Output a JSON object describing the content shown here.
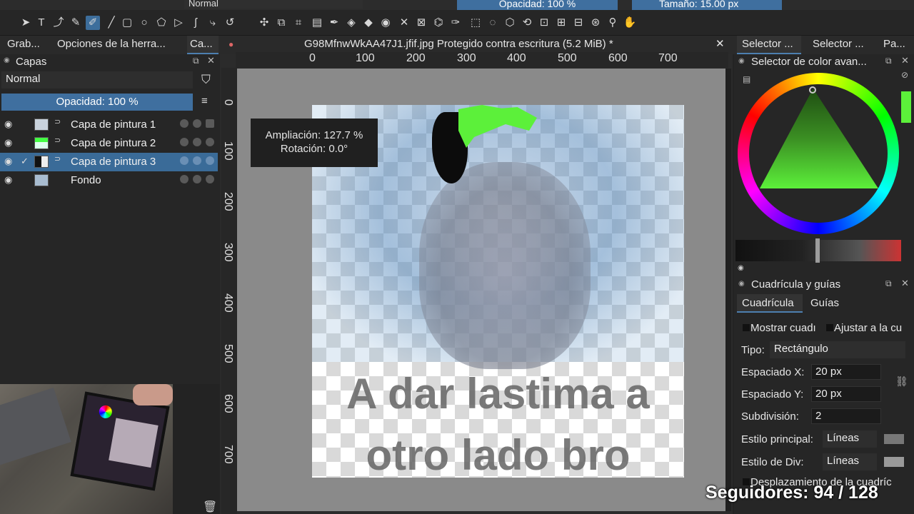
{
  "top": {
    "blend_mode": "Normal",
    "opacity": "Opacidad: 100 %",
    "size": "Tamaño: 15.00 px"
  },
  "tabs": {
    "left1": "Grab...",
    "left2": "Opciones de la herra...",
    "left3": "Ca...",
    "document": "G98MfnwWkAA47J1.jfif.jpg Protegido contra escritura (5.2 MiB) *",
    "right1": "Selector ...",
    "right2": "Selector ...",
    "right3": "Pa..."
  },
  "layers_panel": {
    "title": "Capas",
    "blend_mode": "Normal",
    "opacity": "Opacidad:  100 %",
    "layers": [
      {
        "name": "Capa de pintura 1",
        "selected": false
      },
      {
        "name": "Capa de pintura 2",
        "selected": false
      },
      {
        "name": "Capa de pintura 3",
        "selected": true
      },
      {
        "name": "Fondo",
        "selected": false
      }
    ]
  },
  "rulers": {
    "h": [
      "0",
      "100",
      "200",
      "300",
      "400",
      "500",
      "600",
      "700"
    ],
    "v": [
      "0",
      "100",
      "200",
      "300",
      "400",
      "500",
      "600",
      "700"
    ]
  },
  "canvas": {
    "zoom_line": "Ampliación: 127.7 %",
    "rotation_line": "Rotación: 0.0°",
    "text_line1": "A dar lastima a",
    "text_line2": "otro lado bro"
  },
  "color_selector": {
    "title": "Selector de color avan..."
  },
  "grid_panel": {
    "title": "Cuadrícula y guías",
    "tab_grid": "Cuadrícula",
    "tab_guides": "Guías",
    "show_grid": "Mostrar cuadı",
    "snap_grid": "Ajustar a la cu",
    "type_label": "Tipo:",
    "type_value": "Rectángulo",
    "spacing_x_label": "Espaciado X:",
    "spacing_x_value": "20 px",
    "spacing_y_label": "Espaciado Y:",
    "spacing_y_value": "20 px",
    "subdivision_label": "Subdivisión:",
    "subdivision_value": "2",
    "main_style_label": "Estilo principal:",
    "main_style_value": "Líneas",
    "div_style_label": "Estilo de Div:",
    "div_style_value": "Líneas",
    "offset_label": "Desplazamiento de la cuadríc"
  },
  "overlay": {
    "followers": "Seguidores: 94 / 128"
  },
  "colors": {
    "accent": "#3f6f9f",
    "foreground_green": "#5cf03a"
  }
}
